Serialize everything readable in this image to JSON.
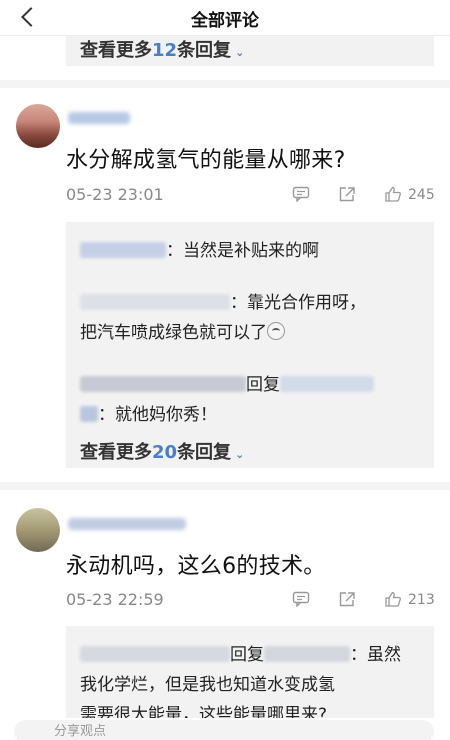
{
  "header": {
    "title": "全部评论"
  },
  "top_reply_box": {
    "more_prefix": "查看更多",
    "more_count": "12",
    "more_suffix": "条回复"
  },
  "comments": [
    {
      "text": "水分解成氢气的能量从哪来?",
      "time": "05-23 23:01",
      "likes": "245",
      "replies": [
        {
          "text": "：当然是补贴来的啊"
        },
        {
          "text_line1": "：靠光合作用呀，",
          "text_line2": "把汽车喷成绿色就可以了"
        },
        {
          "reply_word": "回复",
          "text": "：就他妈你秀！"
        }
      ],
      "more_prefix": "查看更多",
      "more_count": "20",
      "more_suffix": "条回复"
    },
    {
      "text": "永动机吗，这么6的技术。",
      "time": "05-23 22:59",
      "likes": "213",
      "replies": [
        {
          "reply_word": "回复",
          "text_line1": "：虽然",
          "text_line2": "我化学烂，但是我也知道水变成氢",
          "text_line3": "需要很大能量，这些能量哪里来?"
        }
      ]
    }
  ],
  "bottom": {
    "placeholder": "分享观点"
  }
}
